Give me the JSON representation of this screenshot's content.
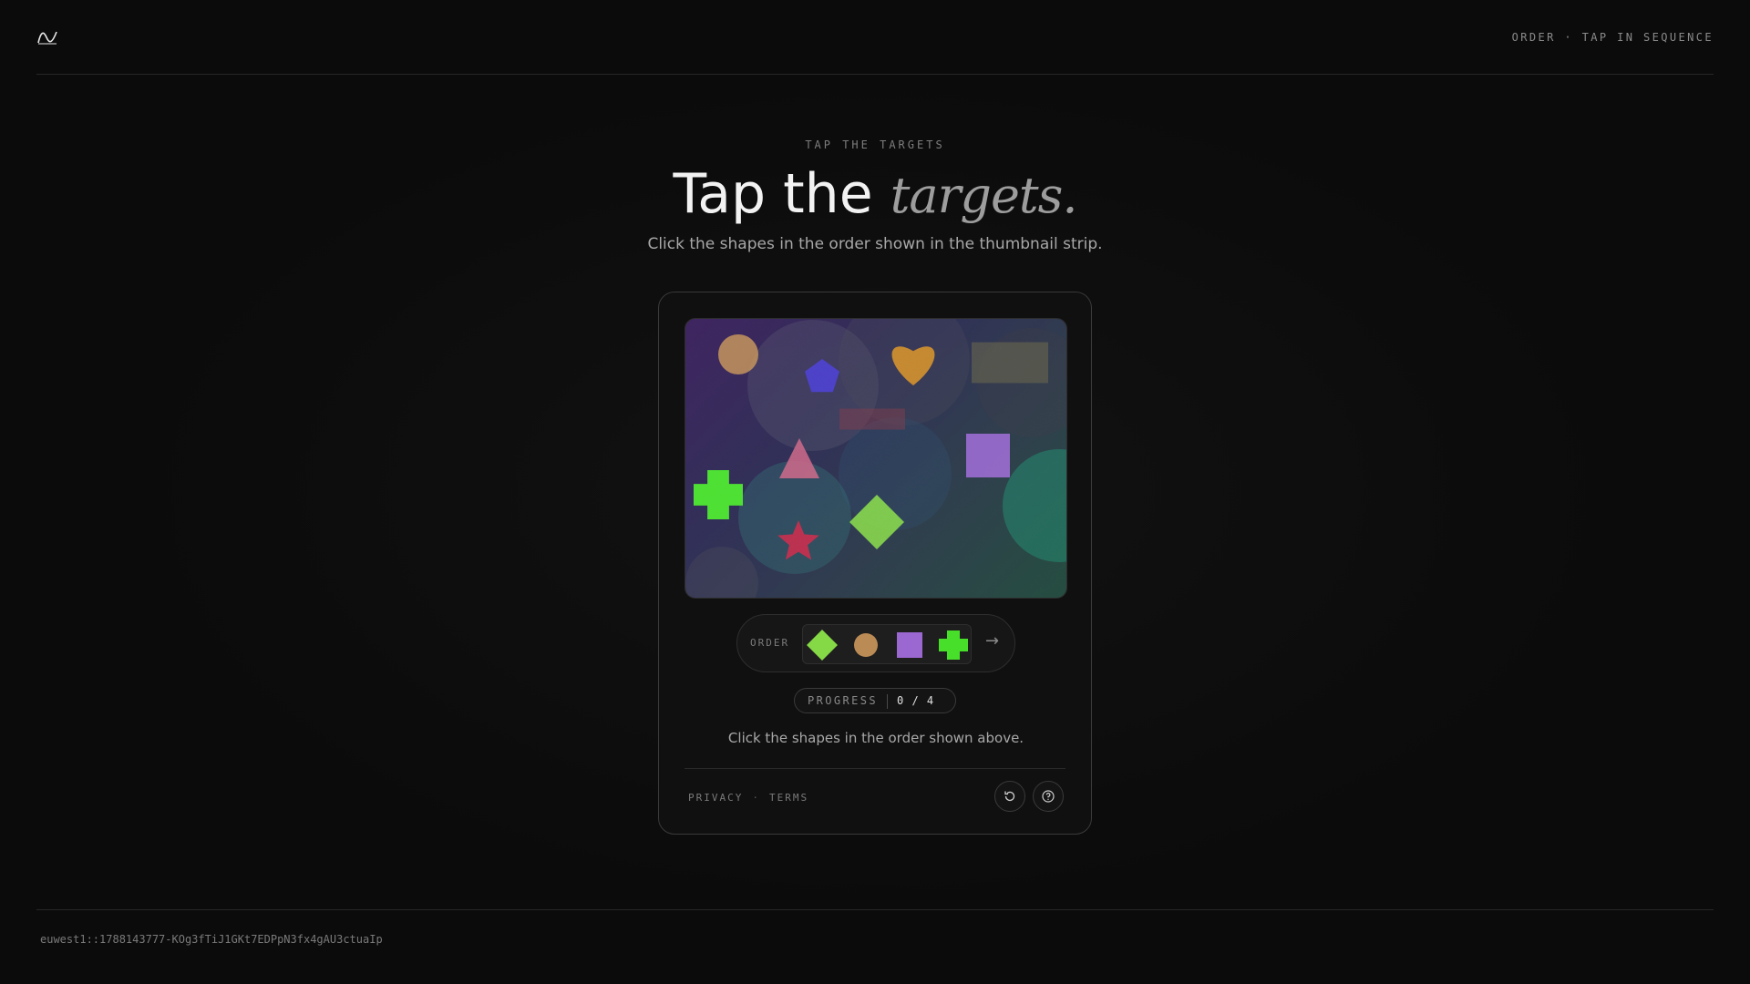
{
  "header": {
    "logo_icon": "wave-logo-icon",
    "meta": "ORDER · TAP IN SEQUENCE"
  },
  "hero": {
    "eyebrow": "TAP THE TARGETS",
    "title_plain": "Tap the ",
    "title_accent": "targets.",
    "subtitle": "Click the shapes in the order shown in the thumbnail strip."
  },
  "challenge": {
    "canvas_shapes": [
      {
        "name": "tan-circle",
        "color": "#c9955a"
      },
      {
        "name": "blue-pentagon",
        "color": "#4a3fd8"
      },
      {
        "name": "orange-heart",
        "color": "#d99428"
      },
      {
        "name": "gray-rectangle",
        "color": "#6e6a4a"
      },
      {
        "name": "red-bar",
        "color": "#8a3a4a"
      },
      {
        "name": "pink-triangle",
        "color": "#d66a8c"
      },
      {
        "name": "violet-square",
        "color": "#a66ee0"
      },
      {
        "name": "green-cross",
        "color": "#4cf02c"
      },
      {
        "name": "lime-diamond",
        "color": "#8ee84a"
      },
      {
        "name": "crimson-star",
        "color": "#d8284a"
      }
    ],
    "order_label": "ORDER",
    "order_sequence": [
      "lime-diamond",
      "tan-circle",
      "violet-square",
      "green-cross"
    ],
    "progress_label": "PROGRESS",
    "progress_value": "0 / 4",
    "progress_done": 0,
    "progress_total": 4,
    "instruction": "Click the shapes in the order shown above.",
    "next_icon": "arrow-right-icon"
  },
  "card_footer": {
    "privacy": "PRIVACY",
    "separator": "·",
    "terms": "TERMS",
    "refresh_icon": "refresh-icon",
    "help_icon": "help-icon"
  },
  "footer": {
    "session_id": "euwest1::1788143777-KOg3fTiJ1GKt7EDPpN3fx4gAU3ctuaIp"
  }
}
